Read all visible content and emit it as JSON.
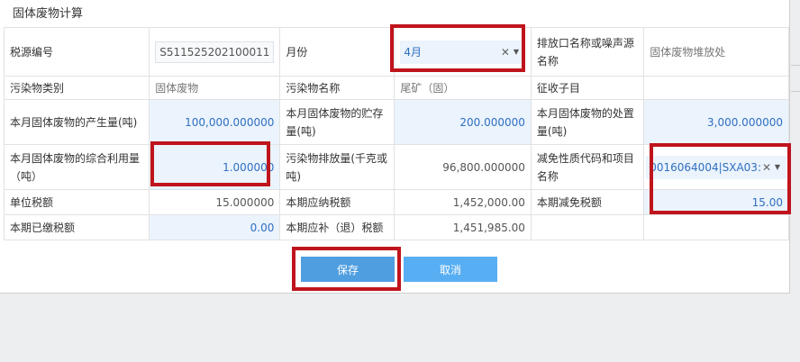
{
  "dialog": {
    "title": "固体废物计算"
  },
  "form": {
    "row1": {
      "tax_id_label": "税源编号",
      "tax_id_value": "S511525202100011",
      "month_label": "月份",
      "month_value": "4月",
      "outlet_label": "排放口名称或噪声源名称",
      "outlet_value": "固体废物堆放处"
    },
    "row2": {
      "pollutant_cat_label": "污染物类别",
      "pollutant_cat_value": "固体废物",
      "pollutant_name_label": "污染物名称",
      "pollutant_name_value": "尾矿（固）",
      "subject_label": "征收子目",
      "subject_value": ""
    },
    "row3": {
      "produced_label": "本月固体废物的产生量(吨)",
      "produced_value": "100,000.000000",
      "stored_label": "本月固体废物的贮存量(吨)",
      "stored_value": "200.000000",
      "disposed_label": "本月固体废物的处置量(吨)",
      "disposed_value": "3,000.000000"
    },
    "row4": {
      "utilized_label": "本月固体废物的综合利用量（吨）",
      "utilized_value": "1.000000",
      "emission_label": "污染物排放量(千克或吨)",
      "emission_value": "96,800.000000",
      "exemption_label": "减免性质代码和项目名称",
      "exemption_value": "0016064004|SXA03:"
    },
    "row5": {
      "unit_tax_label": "单位税额",
      "unit_tax_value": "15.000000",
      "payable_label": "本期应纳税额",
      "payable_value": "1,452,000.00",
      "reduction_label": "本期减免税额",
      "reduction_value": "15.00"
    },
    "row6": {
      "paid_label": "本期已缴税额",
      "paid_value": "0.00",
      "refund_label": "本期应补（退）税额",
      "refund_value": "1,451,985.00"
    }
  },
  "buttons": {
    "save": "保存",
    "cancel": "取消"
  },
  "colors": {
    "highlight": "#c0141c",
    "save_button": "#4f9ee0",
    "cancel_button": "#58aef2",
    "editable_cell": "#ebf3fc"
  },
  "icons": {
    "clear": "close-icon",
    "dropdown": "caret-down-icon"
  }
}
